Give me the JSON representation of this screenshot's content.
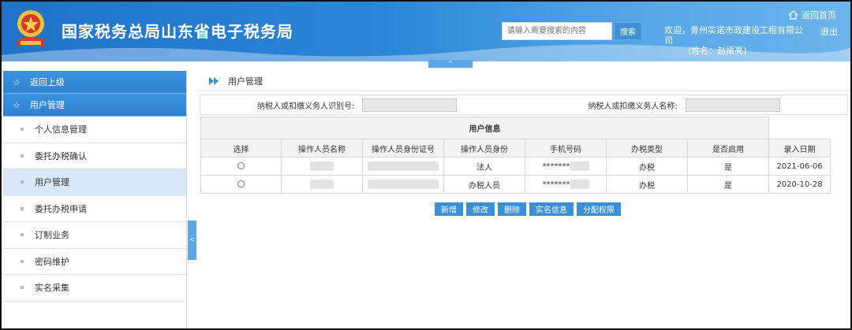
{
  "header": {
    "site_title": "国家税务总局山东省电子税务局",
    "search_placeholder": "请输入需要搜索的内容",
    "search_button": "搜索",
    "home_link": "返回首页",
    "welcome": "欢迎，青州实诺市政建设工程有限公司",
    "user_name": "(姓名：赵振亮)",
    "logout": "退出",
    "collapse_up": "^"
  },
  "sidebar": {
    "back": "返回上级",
    "section": "用户管理",
    "items": [
      {
        "label": "个人信息管理"
      },
      {
        "label": "委托办税确认"
      },
      {
        "label": "用户管理"
      },
      {
        "label": "委托办税申请"
      },
      {
        "label": "订制业务"
      },
      {
        "label": "密码维护"
      },
      {
        "label": "实名采集"
      }
    ],
    "toggle": "<"
  },
  "main": {
    "breadcrumb": "用户管理",
    "filter": {
      "taxpayer_id_label": "纳税人或扣缴义务人识别号:",
      "taxpayer_name_label": "纳税人或扣缴义务人名称:"
    },
    "table": {
      "title": "用户信息",
      "columns": [
        "选择",
        "操作人员名称",
        "操作人员身份证号",
        "操作人员身份",
        "手机号码",
        "办税类型",
        "是否启用",
        "录入日期"
      ],
      "rows": [
        {
          "identity": "法人",
          "phone": "*******",
          "tax_type": "办税",
          "enabled": "是",
          "date": "2021-06-06"
        },
        {
          "identity": "办税人员",
          "phone": "*******",
          "tax_type": "办税",
          "enabled": "是",
          "date": "2020-10-28"
        }
      ]
    },
    "actions": {
      "add": "新增",
      "edit": "修改",
      "delete": "删除",
      "real_name": "实名信息",
      "assign": "分配权限"
    }
  },
  "colors": {
    "header_start": "#1f73c9",
    "header_end": "#6cb4ec",
    "accent": "#3b8fd8",
    "active_item": "#d9e8f6"
  }
}
